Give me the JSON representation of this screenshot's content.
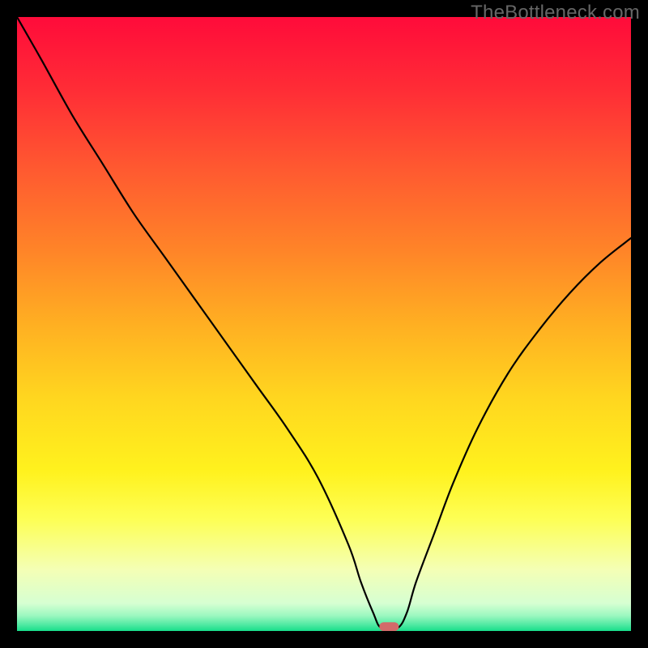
{
  "watermark": "TheBottleneck.com",
  "chart_data": {
    "type": "line",
    "title": "",
    "xlabel": "",
    "ylabel": "",
    "xlim": [
      0,
      100
    ],
    "ylim": [
      0,
      100
    ],
    "grid": false,
    "legend": false,
    "series": [
      {
        "name": "bottleneck-curve",
        "x": [
          0,
          4,
          9,
          14,
          19,
          24,
          29,
          34,
          39,
          44,
          49,
          54,
          56,
          58,
          59.3,
          62,
          63.5,
          65,
          68,
          71,
          75,
          80,
          85,
          90,
          95,
          100
        ],
        "y": [
          100,
          93,
          84,
          76,
          68,
          61,
          54,
          47,
          40,
          33,
          25,
          14,
          8,
          3,
          0.5,
          0.5,
          3,
          8,
          16,
          24,
          33,
          42,
          49,
          55,
          60,
          64
        ]
      }
    ],
    "marker": {
      "name": "optimal-marker",
      "x": 60.6,
      "y": 0.7,
      "color": "#d36a6a"
    },
    "background": {
      "type": "vertical-gradient",
      "stops": [
        {
          "pos": 0.0,
          "color": "#ff0b3a"
        },
        {
          "pos": 0.12,
          "color": "#ff2d36"
        },
        {
          "pos": 0.25,
          "color": "#ff5a30"
        },
        {
          "pos": 0.38,
          "color": "#ff8428"
        },
        {
          "pos": 0.5,
          "color": "#ffaf22"
        },
        {
          "pos": 0.62,
          "color": "#ffd61f"
        },
        {
          "pos": 0.74,
          "color": "#fff21e"
        },
        {
          "pos": 0.82,
          "color": "#fdff57"
        },
        {
          "pos": 0.9,
          "color": "#f4ffb5"
        },
        {
          "pos": 0.955,
          "color": "#d6ffd2"
        },
        {
          "pos": 0.975,
          "color": "#9cf8c0"
        },
        {
          "pos": 0.99,
          "color": "#4fe9a2"
        },
        {
          "pos": 1.0,
          "color": "#17de8a"
        }
      ]
    }
  }
}
